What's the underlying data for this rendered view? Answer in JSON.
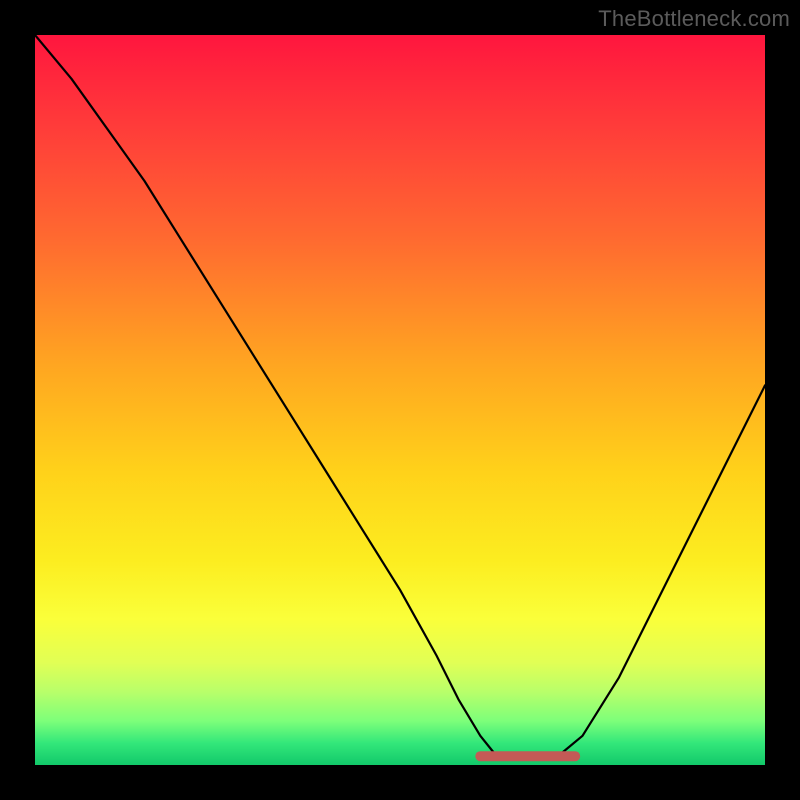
{
  "watermark": "TheBottleneck.com",
  "colors": {
    "frame_bg": "#000000",
    "watermark": "#5b5b5b",
    "curve": "#000000",
    "marker": "#c45a56",
    "gradient_stops": [
      "#ff163e",
      "#ff3a3a",
      "#ff6a30",
      "#ffa521",
      "#ffd21a",
      "#fced20",
      "#faff3a",
      "#e1ff55",
      "#b8ff6a",
      "#7cff7a",
      "#33e77a",
      "#12c96a"
    ]
  },
  "chart_data": {
    "type": "line",
    "title": "",
    "xlabel": "",
    "ylabel": "",
    "xlim": [
      0,
      100
    ],
    "ylim": [
      0,
      100
    ],
    "note": "x is horizontal position (% of plot width), y is mismatch percentage where 0 is bottom/optimal and 100 is top. Curve dips to ~0 around x≈63–72 then rises again. Bottom marker spans the near-zero region.",
    "series": [
      {
        "name": "bottleneck-curve",
        "x": [
          0,
          5,
          10,
          15,
          20,
          25,
          30,
          35,
          40,
          45,
          50,
          55,
          58,
          61,
          63,
          66,
          69,
          72,
          75,
          80,
          85,
          90,
          95,
          100
        ],
        "y": [
          100,
          94,
          87,
          80,
          72,
          64,
          56,
          48,
          40,
          32,
          24,
          15,
          9,
          4,
          1.5,
          0.8,
          0.8,
          1.5,
          4,
          12,
          22,
          32,
          42,
          52
        ]
      }
    ],
    "marker": {
      "name": "optimal-range",
      "x_start": 61,
      "x_end": 74,
      "y": 1.2
    }
  }
}
